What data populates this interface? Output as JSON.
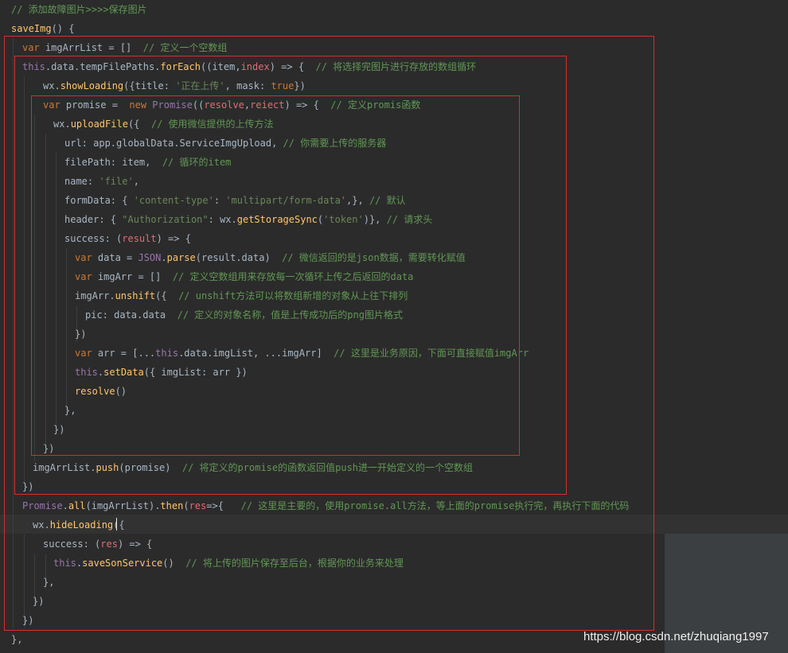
{
  "palette": {
    "background": "#2b2b2b",
    "plain": "#a9b7c6",
    "keyword": "#cc7832",
    "this": "#9876aa",
    "method": "#ffc66d",
    "string": "#6a8759",
    "comment": "#629755",
    "param": "#e06c75",
    "boolean": "#cc7832",
    "class": "#9876aa",
    "highlight_box": "#d32f2f"
  },
  "editor": {
    "lines": [
      [
        [
          "comment",
          "// 添加故障图片>>>>保存图片"
        ]
      ],
      [
        [
          "method",
          "saveImg"
        ],
        [
          "plain",
          "() {"
        ]
      ],
      [
        [
          "keyword",
          "var "
        ],
        [
          "plain",
          "imgArrList = []  "
        ],
        [
          "comment",
          "// 定义一个空数组"
        ]
      ],
      [
        [
          "this",
          "this"
        ],
        [
          "plain",
          ".data.tempFilePaths."
        ],
        [
          "method",
          "forEach"
        ],
        [
          "plain",
          "(("
        ],
        [
          "plain",
          "item"
        ],
        [
          "plain",
          ","
        ],
        [
          "param",
          "index"
        ],
        [
          "plain",
          ") => {  "
        ],
        [
          "comment",
          "// 将选择完图片进行存放的数组循环"
        ]
      ],
      [
        [
          "plain",
          "wx."
        ],
        [
          "method",
          "showLoading"
        ],
        [
          "plain",
          "({title: "
        ],
        [
          "string",
          "'正在上传'"
        ],
        [
          "plain",
          ", mask: "
        ],
        [
          "boolean",
          "true"
        ],
        [
          "plain",
          "})"
        ]
      ],
      [
        [
          "keyword",
          "var "
        ],
        [
          "plain",
          "promise =  "
        ],
        [
          "keyword",
          "new "
        ],
        [
          "class",
          "Promise"
        ],
        [
          "plain",
          "(("
        ],
        [
          "param",
          "resolve"
        ],
        [
          "plain",
          ","
        ],
        [
          "param",
          "reiect"
        ],
        [
          "plain",
          ") => {  "
        ],
        [
          "comment",
          "// 定义promis函数"
        ]
      ],
      [
        [
          "plain",
          "wx."
        ],
        [
          "method",
          "uploadFile"
        ],
        [
          "plain",
          "({  "
        ],
        [
          "comment",
          "// 使用微信提供的上传方法"
        ]
      ],
      [
        [
          "plain",
          "url: app.globalData.ServiceImgUpload, "
        ],
        [
          "comment",
          "// 你需要上传的服务器"
        ]
      ],
      [
        [
          "plain",
          "filePath: item,  "
        ],
        [
          "comment",
          "// 循环的item"
        ]
      ],
      [
        [
          "plain",
          "name: "
        ],
        [
          "string",
          "'file'"
        ],
        [
          "plain",
          ","
        ]
      ],
      [
        [
          "plain",
          "formData: { "
        ],
        [
          "string",
          "'content-type'"
        ],
        [
          "plain",
          ": "
        ],
        [
          "string",
          "'multipart/form-data'"
        ],
        [
          "plain",
          ",}, "
        ],
        [
          "comment",
          "// 默认"
        ]
      ],
      [
        [
          "plain",
          "header: { "
        ],
        [
          "string",
          "\"Authorization\""
        ],
        [
          "plain",
          ": wx."
        ],
        [
          "method",
          "getStorageSync"
        ],
        [
          "plain",
          "("
        ],
        [
          "string",
          "'token'"
        ],
        [
          "plain",
          ")}, "
        ],
        [
          "comment",
          "// 请求头"
        ]
      ],
      [
        [
          "plain",
          "success: ("
        ],
        [
          "param",
          "result"
        ],
        [
          "plain",
          ") => {"
        ]
      ],
      [
        [
          "keyword",
          "var "
        ],
        [
          "plain",
          "data = "
        ],
        [
          "this",
          "JSON"
        ],
        [
          "plain",
          "."
        ],
        [
          "method",
          "parse"
        ],
        [
          "plain",
          "(result.data)  "
        ],
        [
          "comment",
          "// 微信返回的是json数据，需要转化赋值"
        ]
      ],
      [
        [
          "keyword",
          "var "
        ],
        [
          "plain",
          "imgArr = []  "
        ],
        [
          "comment",
          "// 定义空数组用来存放每一次循环上传之后返回的data"
        ]
      ],
      [
        [
          "plain",
          "imgArr."
        ],
        [
          "method",
          "unshift"
        ],
        [
          "plain",
          "({  "
        ],
        [
          "comment",
          "// unshift方法可以将数组新增的对象从上往下排列"
        ]
      ],
      [
        [
          "plain",
          "pic: data.data  "
        ],
        [
          "comment",
          "// 定义的对象名称，值是上传成功后的png图片格式"
        ]
      ],
      [
        [
          "plain",
          "})"
        ]
      ],
      [
        [
          "keyword",
          "var "
        ],
        [
          "plain",
          "arr = [..."
        ],
        [
          "this",
          "this"
        ],
        [
          "plain",
          ".data.imgList, ...imgArr]  "
        ],
        [
          "comment",
          "// 这里是业务原因，下面可直接赋值imgArr"
        ]
      ],
      [
        [
          "this",
          "this"
        ],
        [
          "plain",
          "."
        ],
        [
          "method",
          "setData"
        ],
        [
          "plain",
          "({ imgList: arr })"
        ]
      ],
      [
        [
          "method",
          "resolve"
        ],
        [
          "plain",
          "()"
        ]
      ],
      [
        [
          "plain",
          "},"
        ]
      ],
      [
        [
          "plain",
          "})"
        ]
      ],
      [
        [
          "plain",
          "})"
        ]
      ],
      [
        [
          "plain",
          "imgArrList."
        ],
        [
          "method",
          "push"
        ],
        [
          "plain",
          "(promise)  "
        ],
        [
          "comment",
          "// 将定义的promise的函数返回值push进一开始定义的一个空数组"
        ]
      ],
      [
        [
          "plain",
          "})"
        ]
      ],
      [
        [
          "class",
          "Promise"
        ],
        [
          "plain",
          "."
        ],
        [
          "method",
          "all"
        ],
        [
          "plain",
          "(imgArrList)."
        ],
        [
          "method",
          "then"
        ],
        [
          "plain",
          "("
        ],
        [
          "param",
          "res"
        ],
        [
          "plain",
          "=>{   "
        ],
        [
          "comment",
          "// 这里是主要的，使用promise.all方法，等上面的promise执行完，再执行下面的代码"
        ]
      ],
      [
        [
          "plain",
          "wx."
        ],
        [
          "method",
          "hideLoading"
        ],
        [
          "plain",
          "({"
        ]
      ],
      [
        [
          "plain",
          "success: ("
        ],
        [
          "param",
          "res"
        ],
        [
          "plain",
          ") => {"
        ]
      ],
      [
        [
          "this",
          "this"
        ],
        [
          "plain",
          "."
        ],
        [
          "method",
          "saveSonService"
        ],
        [
          "plain",
          "()  "
        ],
        [
          "comment",
          "// 将上传的图片保存至后台，根据你的业务来处理"
        ]
      ],
      [
        [
          "plain",
          "},"
        ]
      ],
      [
        [
          "plain",
          "})"
        ]
      ],
      [
        [
          "plain",
          "})"
        ]
      ],
      [
        [
          "plain",
          "},"
        ]
      ]
    ]
  },
  "watermark": "https://blog.csdn.net/zhuqiang1997"
}
